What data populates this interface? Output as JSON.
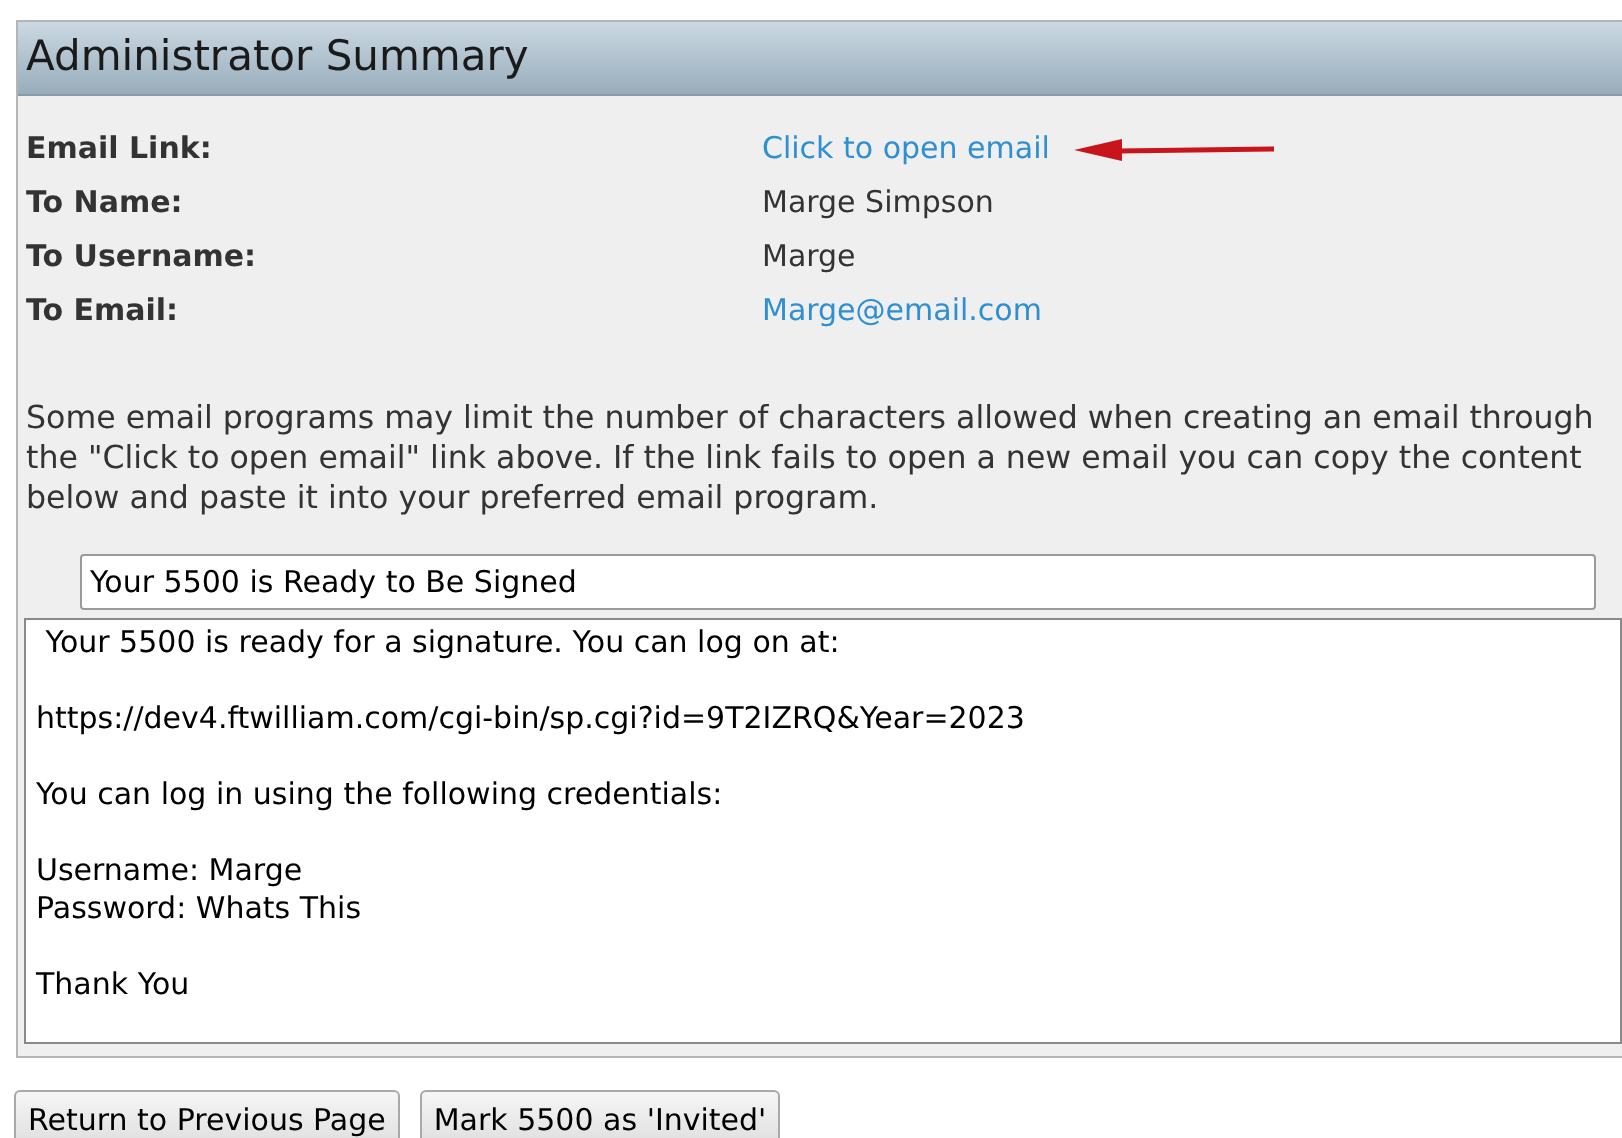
{
  "panel": {
    "title": "Administrator Summary",
    "fields": [
      {
        "label": "Email Link:",
        "value": "Click to open email",
        "kind": "link",
        "arrow": true
      },
      {
        "label": "To Name:",
        "value": "Marge Simpson",
        "kind": "text",
        "arrow": false
      },
      {
        "label": "To Username:",
        "value": "Marge",
        "kind": "text",
        "arrow": false
      },
      {
        "label": "To Email:",
        "value": "Marge@email.com",
        "kind": "link",
        "arrow": false
      }
    ],
    "note": "Some email programs may limit the number of characters allowed when creating an email through the \"Click to open email\" link above. If the link fails to open a new email you can copy the content below and paste it into your preferred email program.",
    "subject": "Your 5500 is Ready to Be Signed",
    "message": " Your 5500 is ready for a signature. You can log on at:\n\nhttps://dev4.ftwilliam.com/cgi-bin/sp.cgi?id=9T2IZRQ&Year=2023\n\nYou can log in using the following credentials:\n\nUsername: Marge\nPassword: Whats This\n\nThank You"
  },
  "buttons": [
    "Return to Previous Page",
    "Mark 5500 as 'Invited'"
  ]
}
